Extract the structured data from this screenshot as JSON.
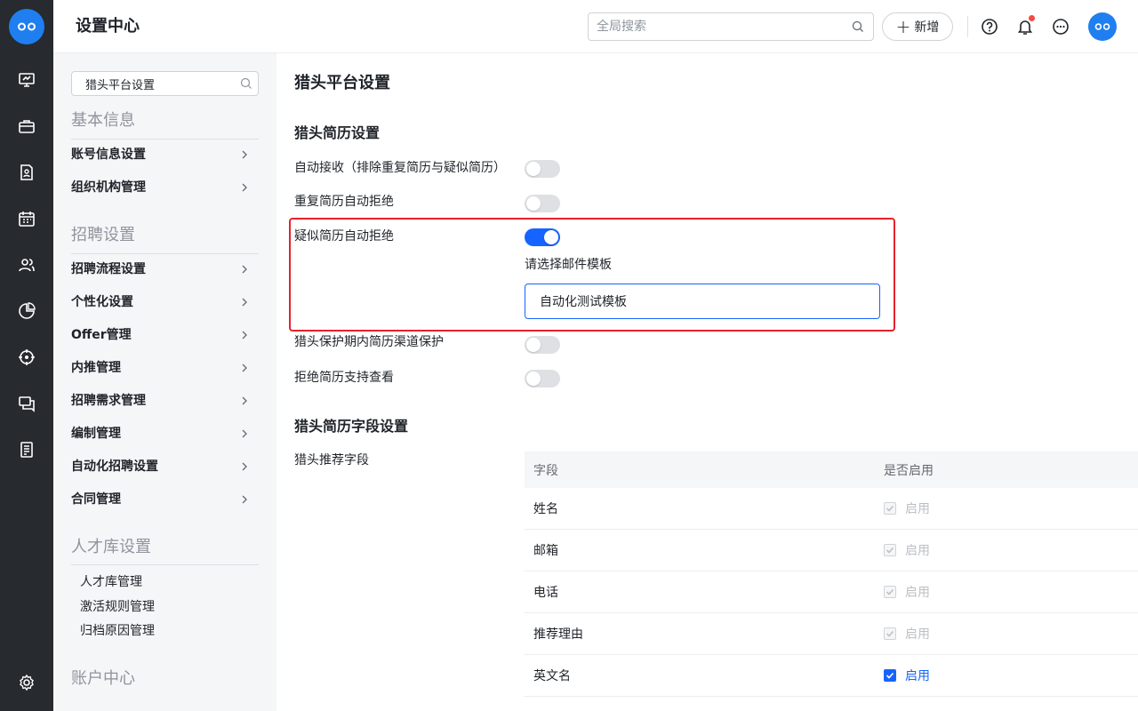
{
  "header": {
    "title": "设置中心",
    "search_placeholder": "全局搜索",
    "add_label": "新增"
  },
  "sidebar": {
    "search_value": "猎头平台设置",
    "sections": {
      "basic": {
        "title": "基本信息",
        "items": [
          "账号信息设置",
          "组织机构管理"
        ]
      },
      "recruit": {
        "title": "招聘设置",
        "items": [
          "招聘流程设置",
          "个性化设置",
          "Offer管理",
          "内推管理",
          "招聘需求管理",
          "编制管理",
          "自动化招聘设置",
          "合同管理"
        ]
      },
      "talent": {
        "title": "人才库设置",
        "items": [
          "人才库管理",
          "激活规则管理",
          "归档原因管理"
        ]
      },
      "account": {
        "title": "账户中心"
      }
    }
  },
  "main": {
    "title": "猎头平台设置",
    "resume_settings": {
      "title": "猎头简历设置",
      "rows": [
        {
          "label": "自动接收（排除重复简历与疑似简历）",
          "enabled": false
        },
        {
          "label": "重复简历自动拒绝",
          "enabled": false
        },
        {
          "label": "疑似简历自动拒绝",
          "enabled": true
        },
        {
          "label": "猎头保护期内简历渠道保护",
          "enabled": false
        },
        {
          "label": "拒绝简历支持查看",
          "enabled": false
        }
      ],
      "email_template_label": "请选择邮件模板",
      "email_template_value": "自动化测试模板"
    },
    "field_settings": {
      "title": "猎头简历字段设置",
      "row_label": "猎头推荐字段",
      "columns": [
        "字段",
        "是否启用"
      ],
      "enable_label": "启用",
      "rows": [
        {
          "field": "姓名",
          "checked": true,
          "disabled": true
        },
        {
          "field": "邮箱",
          "checked": true,
          "disabled": true
        },
        {
          "field": "电话",
          "checked": true,
          "disabled": true
        },
        {
          "field": "推荐理由",
          "checked": true,
          "disabled": true
        },
        {
          "field": "英文名",
          "checked": true,
          "disabled": false
        }
      ]
    }
  },
  "colors": {
    "accent": "#1664ff",
    "rail": "#272a2e",
    "highlight": "#e5222b",
    "notification": "#f54a45"
  }
}
